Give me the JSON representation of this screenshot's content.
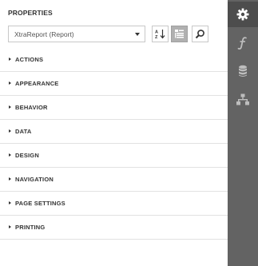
{
  "panel": {
    "title": "PROPERTIES"
  },
  "toolbar": {
    "select_value": "XtraReport (Report)",
    "sort_icon": "sort-az-icon",
    "categorize_icon": "categorize-icon",
    "search_icon": "search-icon"
  },
  "categories": [
    {
      "label": "ACTIONS"
    },
    {
      "label": "APPEARANCE"
    },
    {
      "label": "BEHAVIOR"
    },
    {
      "label": "DATA"
    },
    {
      "label": "DESIGN"
    },
    {
      "label": "NAVIGATION"
    },
    {
      "label": "PAGE SETTINGS"
    },
    {
      "label": "PRINTING"
    }
  ],
  "rail": {
    "items": [
      {
        "icon": "gear-icon",
        "active": true
      },
      {
        "icon": "function-icon",
        "active": false
      },
      {
        "icon": "database-icon",
        "active": false
      },
      {
        "icon": "hierarchy-icon",
        "active": false
      }
    ]
  },
  "colors": {
    "rail_bg": "#636363",
    "rail_active": "#4d4d4d",
    "active_button": "#b0b0b0",
    "divider": "#e2e2e2"
  }
}
